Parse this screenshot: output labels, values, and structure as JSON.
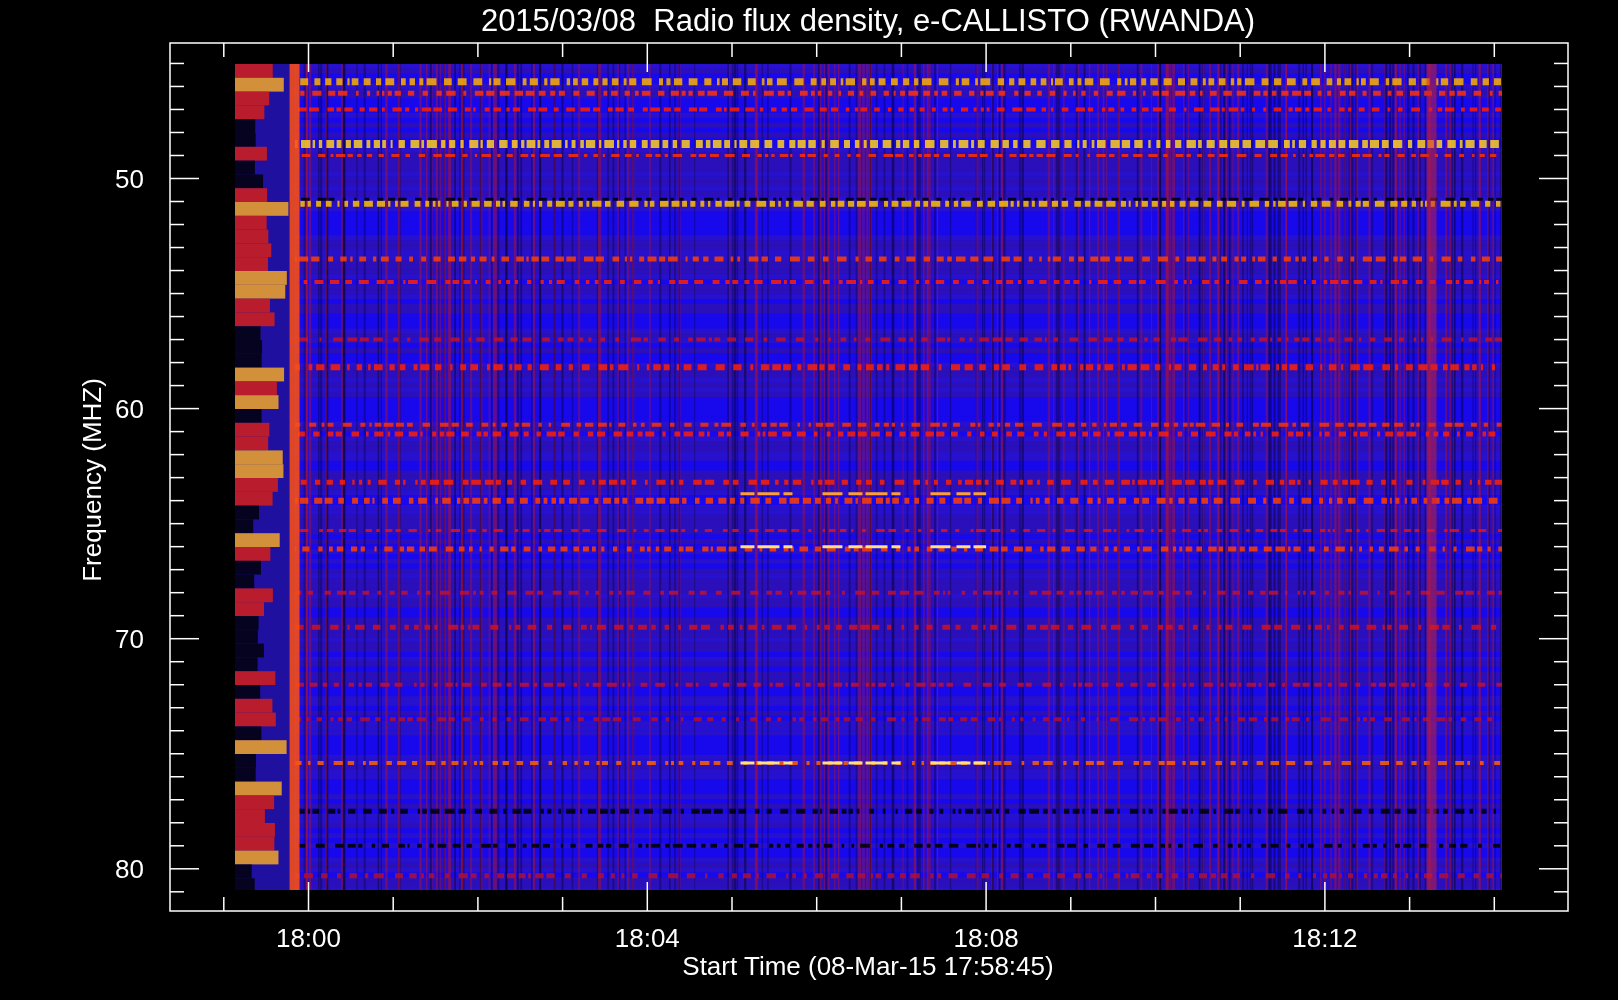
{
  "title": "2015/03/08  Radio flux density, e-CALLISTO (RWANDA)",
  "ylabel": "Frequency (MHZ)",
  "xlabel": "Start Time (08-Mar-15 17:58:45)",
  "yticks": [
    "50",
    "60",
    "70",
    "80"
  ],
  "xticks": [
    "18:00",
    "18:04",
    "18:08",
    "18:12"
  ]
}
